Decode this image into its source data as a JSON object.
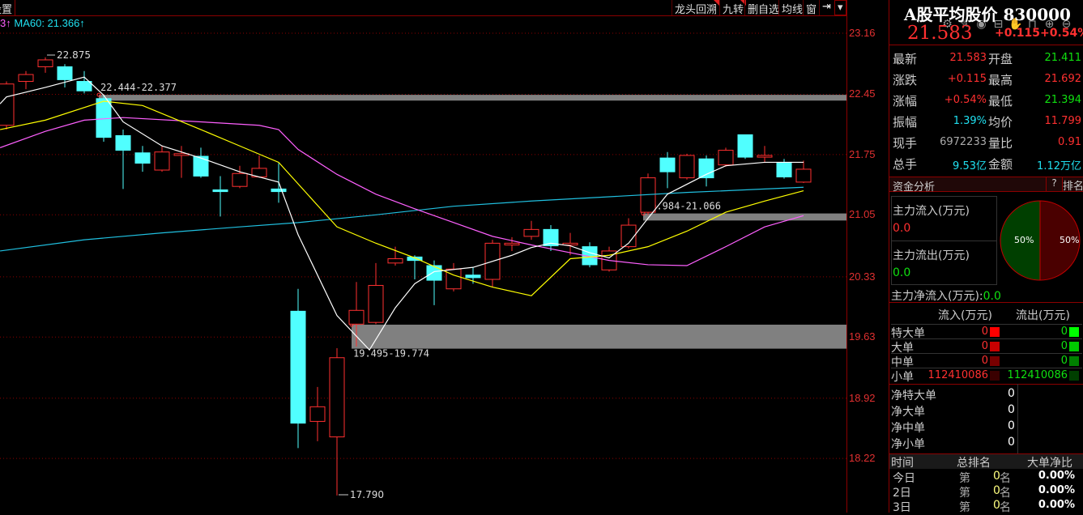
{
  "toolbar": {
    "settings": "设置",
    "tabs": [
      "龙头回溯",
      "九转",
      "删自选",
      "均线",
      "窗"
    ],
    "arrow": "⇥",
    "dropdown": "▾"
  },
  "legend": {
    "prev": "3↑",
    "ma60": "MA60: 21.366↑"
  },
  "tools": [
    "gear-icon",
    "pen-icon",
    "eye-icon",
    "toolbox-icon",
    "hand-icon",
    "lock-icon",
    "zoom-in-icon",
    "zoom-out-icon"
  ],
  "colors": {
    "up": "#ff3030",
    "down": "#50ffff",
    "ma5": "#ffffff",
    "ma10": "#ffff00",
    "ma20": "#ff60ff",
    "ma60": "#20c0e0",
    "band": "#808080"
  },
  "chart_data": {
    "type": "candlestick",
    "y_ticks": [
      "23.16",
      "22.45",
      "21.75",
      "21.05",
      "20.33",
      "19.63",
      "18.92",
      "18.22"
    ],
    "ylim": [
      17.6,
      23.16
    ],
    "candles": [
      [
        22.09,
        22.57,
        22.6,
        22.04
      ],
      [
        22.6,
        22.68,
        22.72,
        22.51
      ],
      [
        22.77,
        22.85,
        22.88,
        22.7
      ],
      [
        22.77,
        22.62,
        22.8,
        22.53
      ],
      [
        22.6,
        22.49,
        22.72,
        22.46
      ],
      [
        22.4,
        21.95,
        22.44,
        21.9
      ],
      [
        21.97,
        21.8,
        22.04,
        21.35
      ],
      [
        21.77,
        21.65,
        21.85,
        21.55
      ],
      [
        21.57,
        21.78,
        21.85,
        21.55
      ],
      [
        21.74,
        21.76,
        21.85,
        21.48
      ],
      [
        21.73,
        21.5,
        21.83,
        21.48
      ],
      [
        21.34,
        21.32,
        21.5,
        21.03
      ],
      [
        21.38,
        21.53,
        21.62,
        21.36
      ],
      [
        21.49,
        21.59,
        21.74,
        21.48
      ],
      [
        21.35,
        21.32,
        21.65,
        21.19
      ],
      [
        19.93,
        18.63,
        20.19,
        18.34
      ],
      [
        18.65,
        18.82,
        19.05,
        18.42
      ],
      [
        18.47,
        19.39,
        19.5,
        17.79
      ],
      [
        19.78,
        19.94,
        20.27,
        19.52
      ],
      [
        19.8,
        20.23,
        20.49,
        19.78
      ],
      [
        20.49,
        20.54,
        20.68,
        20.46
      ],
      [
        20.56,
        20.52,
        20.58,
        20.3
      ],
      [
        20.46,
        20.29,
        20.52,
        20.0
      ],
      [
        20.19,
        20.42,
        20.49,
        20.16
      ],
      [
        20.35,
        20.32,
        20.44,
        20.25
      ],
      [
        20.3,
        20.72,
        20.76,
        20.21
      ],
      [
        20.7,
        20.72,
        20.79,
        20.63
      ],
      [
        20.8,
        20.88,
        20.98,
        20.76
      ],
      [
        20.88,
        20.69,
        20.93,
        20.63
      ],
      [
        20.7,
        20.72,
        20.84,
        20.58
      ],
      [
        20.68,
        20.47,
        20.73,
        20.44
      ],
      [
        20.41,
        20.63,
        20.68,
        20.39
      ],
      [
        20.68,
        20.93,
        21.01,
        20.66
      ],
      [
        21.08,
        21.48,
        21.53,
        21.05
      ],
      [
        21.71,
        21.55,
        21.78,
        21.36
      ],
      [
        21.48,
        21.74,
        21.76,
        21.46
      ],
      [
        21.7,
        21.48,
        21.74,
        21.38
      ],
      [
        21.63,
        21.8,
        21.83,
        21.61
      ],
      [
        21.98,
        21.72,
        21.98,
        21.7
      ],
      [
        21.72,
        21.74,
        21.85,
        21.66
      ],
      [
        21.66,
        21.49,
        21.7,
        21.47
      ],
      [
        21.43,
        21.58,
        21.68,
        21.42
      ]
    ],
    "ma": {
      "ma5": [
        [
          -0.33,
          22.34
        ],
        [
          0,
          22.42
        ],
        [
          2,
          22.53
        ],
        [
          4,
          22.65
        ],
        [
          5,
          22.44
        ],
        [
          6,
          22.13
        ],
        [
          8,
          21.85
        ],
        [
          10,
          21.71
        ],
        [
          12,
          21.55
        ],
        [
          14,
          21.43
        ],
        [
          15,
          20.82
        ],
        [
          17,
          19.88
        ],
        [
          18.67,
          19.48
        ],
        [
          20,
          19.97
        ],
        [
          21,
          20.25
        ],
        [
          22,
          20.39
        ],
        [
          24,
          20.44
        ],
        [
          26,
          20.58
        ],
        [
          27,
          20.67
        ],
        [
          28,
          20.72
        ],
        [
          29,
          20.69
        ],
        [
          30,
          20.61
        ],
        [
          31,
          20.55
        ],
        [
          32,
          20.72
        ],
        [
          33,
          21.01
        ],
        [
          34,
          21.29
        ],
        [
          36,
          21.52
        ],
        [
          37,
          21.62
        ],
        [
          39,
          21.66
        ],
        [
          41,
          21.66
        ]
      ],
      "ma10": [
        [
          -0.33,
          22.04
        ],
        [
          2,
          22.15
        ],
        [
          5,
          22.37
        ],
        [
          7,
          22.32
        ],
        [
          10,
          22.04
        ],
        [
          12,
          21.85
        ],
        [
          14,
          21.66
        ],
        [
          17,
          20.91
        ],
        [
          19,
          20.72
        ],
        [
          21,
          20.55
        ],
        [
          23,
          20.35
        ],
        [
          25,
          20.21
        ],
        [
          27,
          20.11
        ],
        [
          29,
          20.54
        ],
        [
          31,
          20.58
        ],
        [
          33,
          20.68
        ],
        [
          35,
          20.86
        ],
        [
          37,
          21.08
        ],
        [
          39,
          21.21
        ],
        [
          41,
          21.33
        ]
      ],
      "ma20": [
        [
          -0.33,
          21.83
        ],
        [
          2,
          22.02
        ],
        [
          4,
          22.15
        ],
        [
          6,
          22.18
        ],
        [
          10,
          22.13
        ],
        [
          13,
          22.09
        ],
        [
          14,
          22.04
        ],
        [
          15,
          21.81
        ],
        [
          17,
          21.52
        ],
        [
          19,
          21.29
        ],
        [
          21,
          21.12
        ],
        [
          23,
          20.96
        ],
        [
          25,
          20.8
        ],
        [
          27,
          20.7
        ],
        [
          29,
          20.61
        ],
        [
          31,
          20.52
        ],
        [
          33,
          20.47
        ],
        [
          35,
          20.46
        ],
        [
          37,
          20.68
        ],
        [
          39,
          20.91
        ],
        [
          41,
          21.04
        ]
      ],
      "ma60": [
        [
          -0.33,
          20.63
        ],
        [
          4,
          20.76
        ],
        [
          8,
          20.84
        ],
        [
          12,
          20.91
        ],
        [
          15,
          20.96
        ],
        [
          19,
          21.05
        ],
        [
          23,
          21.15
        ],
        [
          27,
          21.21
        ],
        [
          31,
          21.26
        ],
        [
          35,
          21.31
        ],
        [
          39,
          21.35
        ],
        [
          41,
          21.37
        ]
      ]
    },
    "bands": [
      {
        "from_index": 5,
        "low": 22.377,
        "high": 22.444,
        "label": "22.444-22.377"
      },
      {
        "from_index": 33,
        "low": 20.984,
        "high": 21.066,
        "label": "20.984-21.066"
      },
      {
        "from_index": 18,
        "low": 19.495,
        "high": 19.774,
        "label": "19.495-19.774"
      }
    ],
    "annotations": {
      "high": "22.875",
      "low": "17.790"
    }
  },
  "panel": {
    "title": "A股平均股价 830000",
    "price": "21.583",
    "change": "+0.115",
    "pct": "+0.54%",
    "stats": [
      [
        "最新",
        "21.583",
        "开盘",
        "21.411"
      ],
      [
        "涨跌",
        "+0.115",
        "最高",
        "21.692"
      ],
      [
        "涨幅",
        "+0.54%",
        "最低",
        "21.394"
      ],
      [
        "振幅",
        "1.39%",
        "均价",
        "11.799"
      ],
      [
        "现手",
        "6972233",
        "量比",
        "0.91"
      ],
      [
        "总手",
        "9.53亿",
        "金额",
        "1.12万亿"
      ]
    ],
    "fund_title": "资金分析",
    "help": "?",
    "rank": "排名",
    "inflow_label": "主力流入(万元)",
    "inflow": "0.0",
    "outflow_label": "主力流出(万元)",
    "outflow": "0.0",
    "pie_left": "50%",
    "pie_right": "50%",
    "net_label": "主力净流入(万元):",
    "net": "0.0",
    "col_in": "流入(万元)",
    "col_out": "流出(万元)",
    "orders": [
      [
        "特大单",
        "0",
        "0"
      ],
      [
        "大单",
        "0",
        "0"
      ],
      [
        "中单",
        "0",
        "0"
      ],
      [
        "小单",
        "112410086",
        "112410086"
      ]
    ],
    "net_orders": [
      [
        "净特大单",
        "0"
      ],
      [
        "净大单",
        "0"
      ],
      [
        "净中单",
        "0"
      ],
      [
        "净小单",
        "0"
      ]
    ],
    "rank_head": [
      "时间",
      "总排名",
      "大单净比"
    ],
    "ranks": [
      [
        "今日",
        "第",
        "0",
        "名",
        "0.00%"
      ],
      [
        "2日",
        "第",
        "0",
        "名",
        "0.00%"
      ],
      [
        "3日",
        "第",
        "0",
        "名",
        "0.00%"
      ]
    ]
  }
}
